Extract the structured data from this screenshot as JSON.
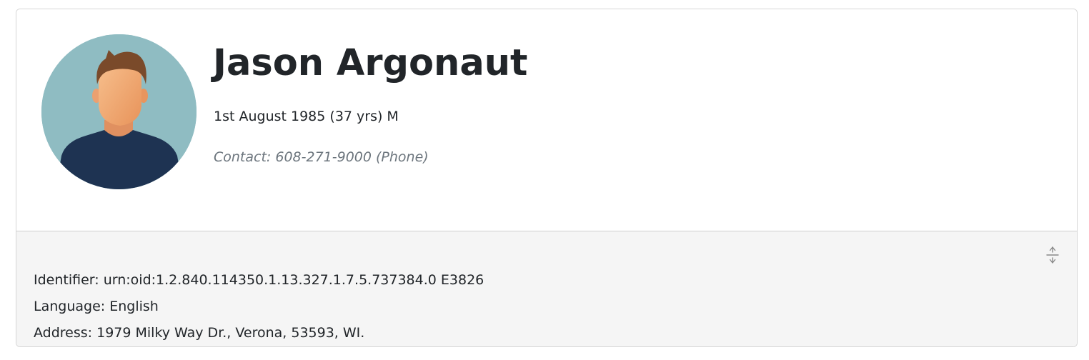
{
  "patient": {
    "name": "Jason Argonaut",
    "demographics": "1st August 1985 (37 yrs) M",
    "contact": "Contact: 608-271-9000 (Phone)"
  },
  "details": {
    "identifier": "Identifier: urn:oid:1.2.840.114350.1.13.327.1.7.5.737384.0 E3826",
    "language": "Language: English",
    "address": "Address: 1979 Milky Way Dr., Verona, 53593, WI."
  },
  "icons": {
    "avatar": "person-avatar-icon",
    "toggle": "expand-collapse-icon"
  },
  "colors": {
    "avatar_bg": "#8fbcc2",
    "skin": "#f0a870",
    "hair": "#7a4a2a",
    "shirt": "#1e3352",
    "footer_bg": "#f5f5f5",
    "muted_text": "#6c757d"
  }
}
